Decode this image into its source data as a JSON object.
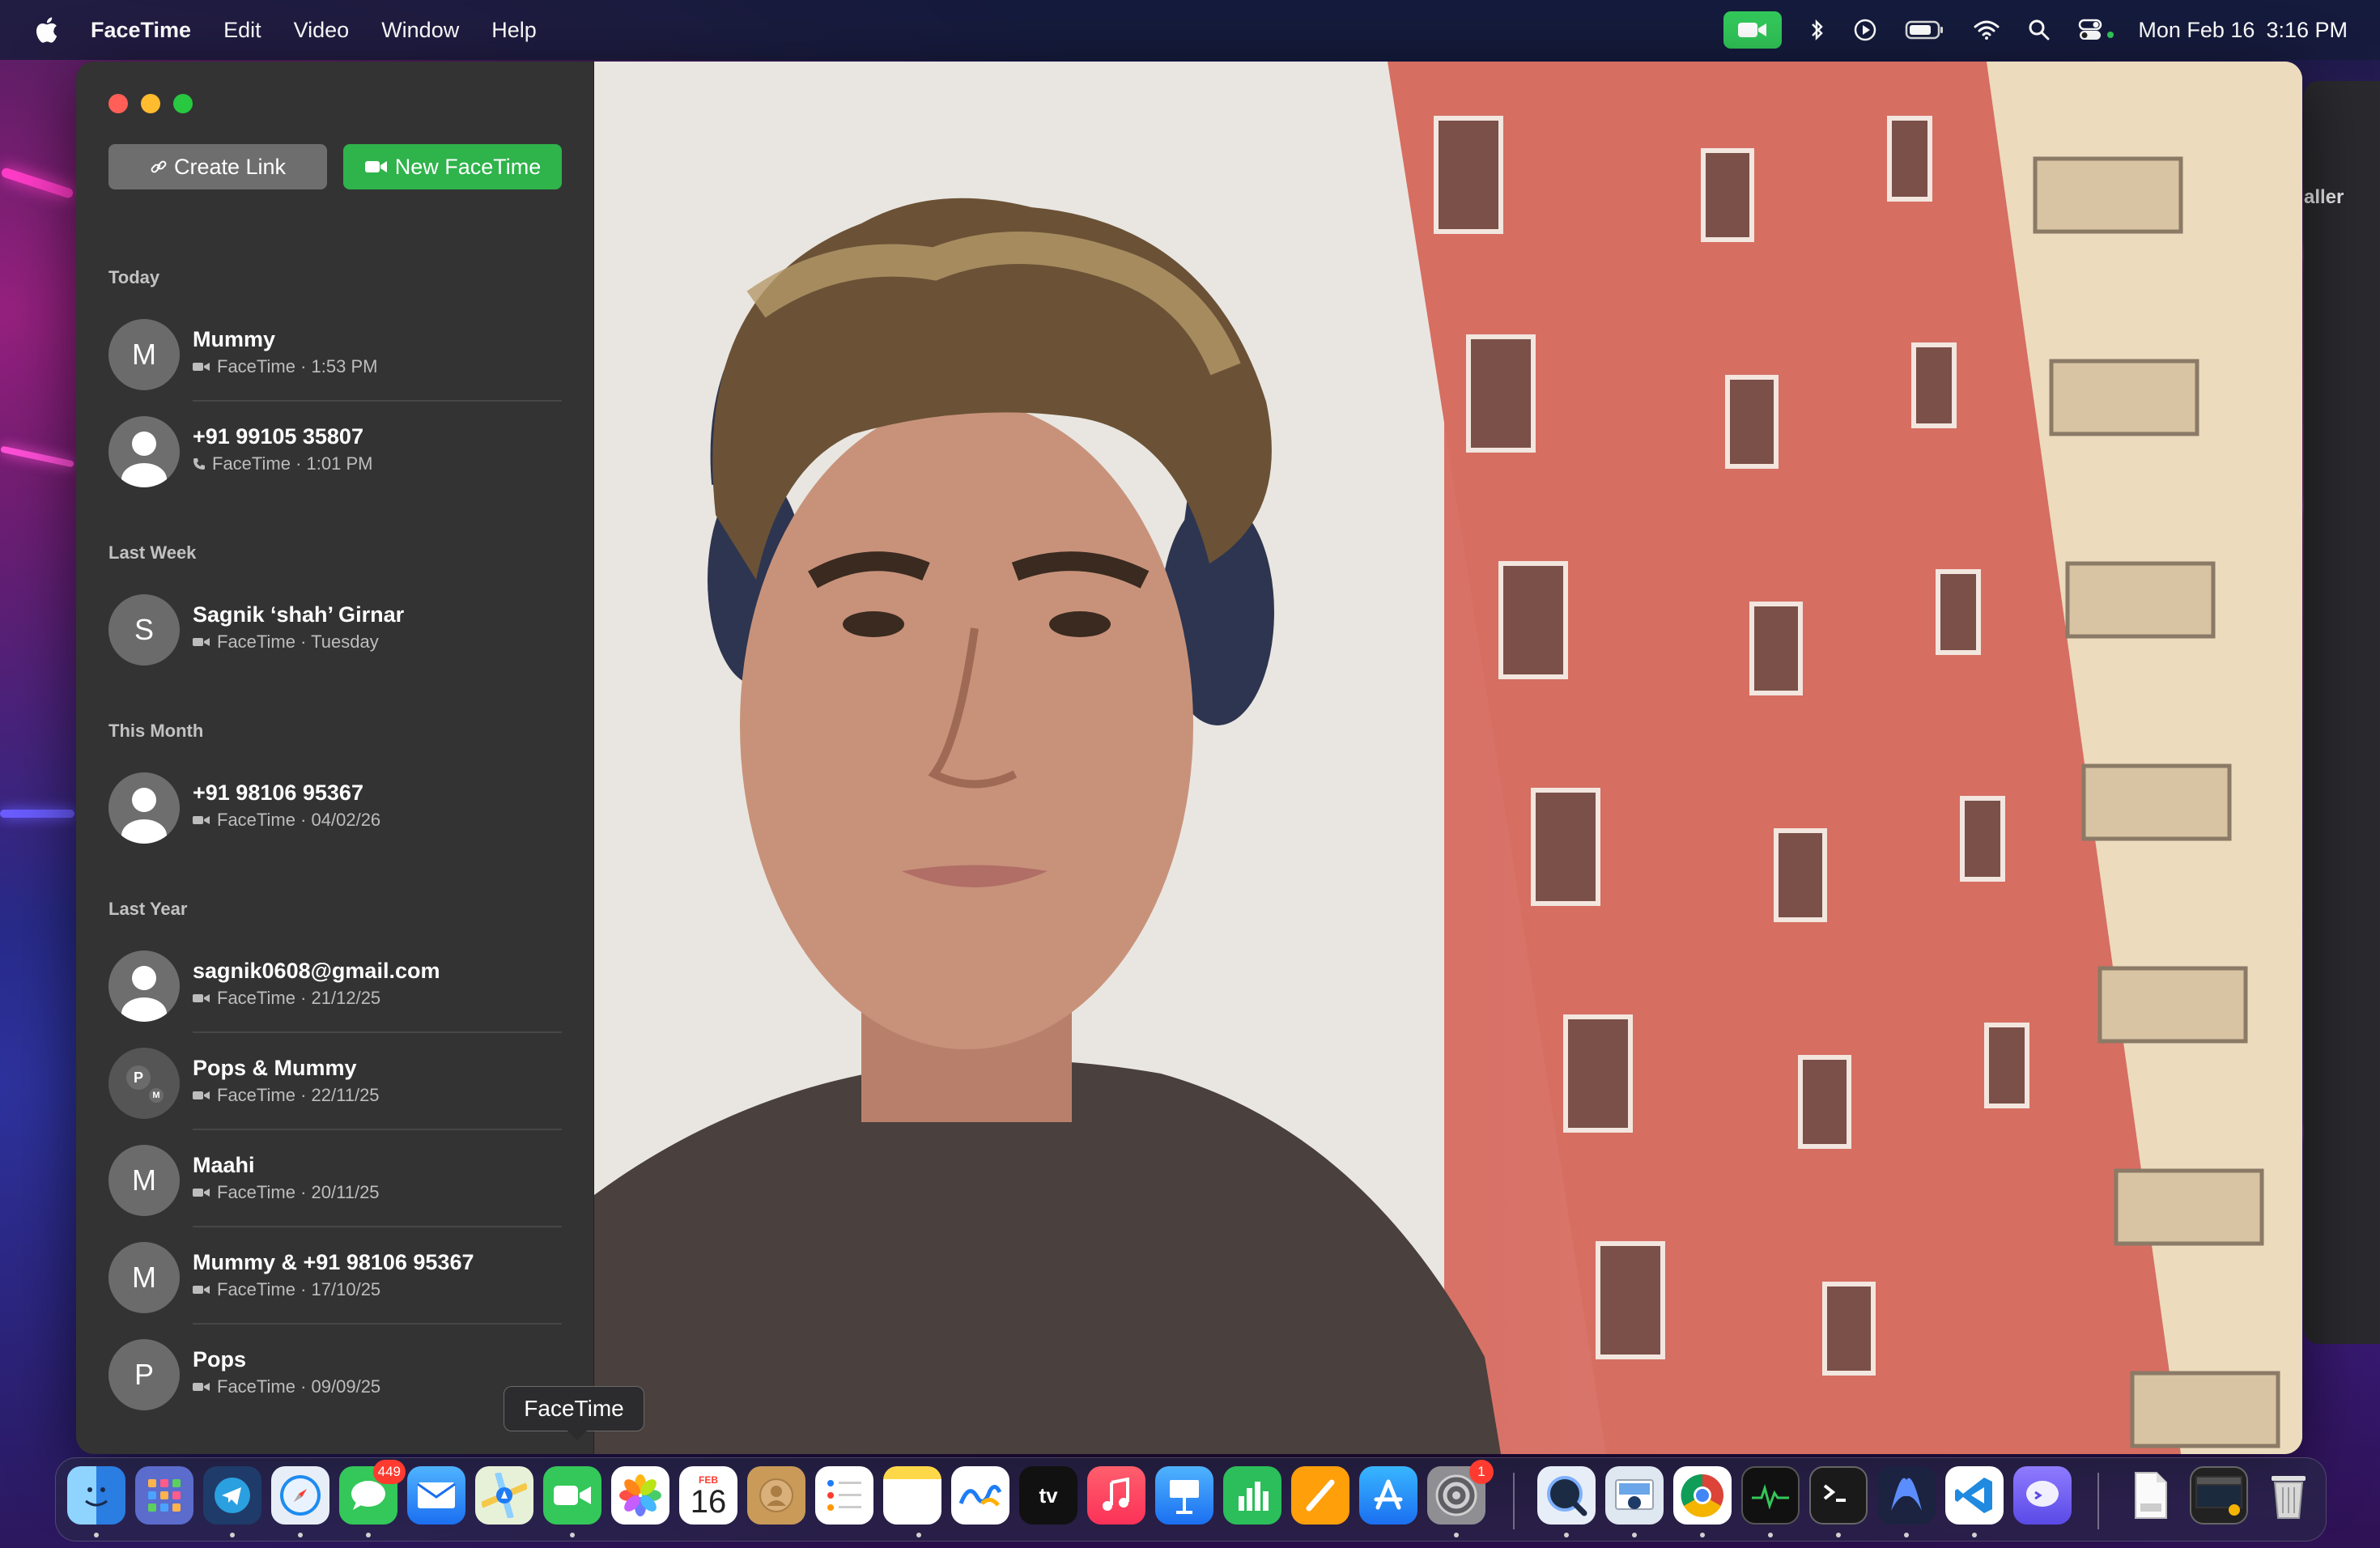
{
  "menubar": {
    "app_name": "FaceTime",
    "items": [
      "Edit",
      "Video",
      "Window",
      "Help"
    ],
    "clock_day": "Mon Feb 16",
    "clock_time": "3:16 PM"
  },
  "sidebar": {
    "create_link_label": "Create Link",
    "new_facetime_label": "New FaceTime",
    "sections": [
      {
        "label": "Today"
      },
      {
        "label": "Last Week"
      },
      {
        "label": "This Month"
      },
      {
        "label": "Last Year"
      }
    ],
    "calls": [
      {
        "initial": "M",
        "name": "Mummy",
        "sub": "FaceTime · 1:53 PM",
        "kind": "video"
      },
      {
        "initial": "",
        "name": "+91 99105 35807",
        "sub": "FaceTime · 1:01 PM",
        "kind": "audio"
      },
      {
        "initial": "S",
        "name": "Sagnik ‘shah’ Girnar",
        "sub": "FaceTime · Tuesday",
        "kind": "video"
      },
      {
        "initial": "",
        "name": "+91 98106 95367",
        "sub": "FaceTime · 04/02/26",
        "kind": "video"
      },
      {
        "initial": "",
        "name": "sagnik0608@gmail.com",
        "sub": "FaceTime · 21/12/25",
        "kind": "video"
      },
      {
        "initial": "P",
        "initial2": "M",
        "name": "Pops & Mummy",
        "sub": "FaceTime · 22/11/25",
        "kind": "video"
      },
      {
        "initial": "M",
        "name": "Maahi",
        "sub": "FaceTime · 20/11/25",
        "kind": "video"
      },
      {
        "initial": "M",
        "name": "Mummy & +91 98106 95367",
        "sub": "FaceTime · 17/10/25",
        "kind": "video"
      },
      {
        "initial": "P",
        "name": "Pops",
        "sub": "FaceTime · 09/09/25",
        "kind": "video"
      }
    ]
  },
  "edge_text": "aller",
  "tooltip": "FaceTime",
  "dock": {
    "messages_badge": "449",
    "settings_badge": "1",
    "calendar_month": "FEB",
    "calendar_day": "16",
    "tv_label": "tv"
  },
  "colors": {
    "accent_green": "#2fb34b",
    "close": "#ff5f57",
    "minimize": "#febc2e",
    "maximize": "#28c840"
  }
}
